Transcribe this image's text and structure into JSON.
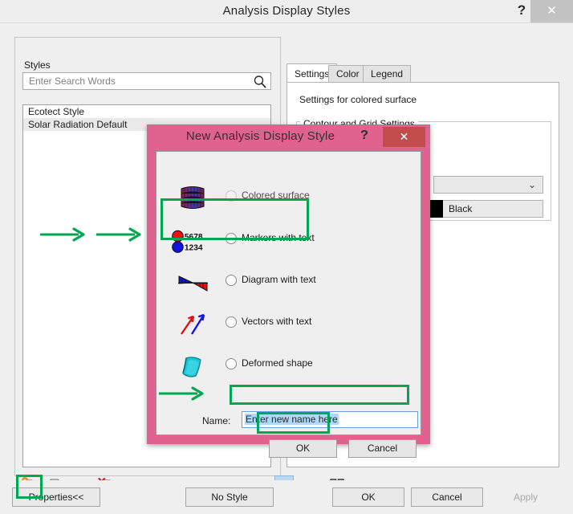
{
  "window": {
    "title": "Analysis Display Styles",
    "help_label": "?",
    "close_label": "✕"
  },
  "styles_panel": {
    "legend": "Styles",
    "search": {
      "placeholder": "Enter Search Words",
      "icon": "search-icon"
    },
    "list_items": [
      {
        "label": "Ecotect Style",
        "selected": false
      },
      {
        "label": "Solar Radiation Default",
        "selected": true
      }
    ],
    "toolbar": {
      "new_style": "new-style-icon",
      "duplicate_style": "duplicate-style-icon",
      "rename_style": "rename-style-icon",
      "delete_style": "delete-style-icon",
      "view_list": "view-list-icon",
      "view_small_icons": "view-small-icons-icon",
      "view_large_icons": "view-large-icons-icon"
    }
  },
  "settings_panel": {
    "tabs": [
      {
        "label": "Settings",
        "active": true
      },
      {
        "label": "Color",
        "active": false
      },
      {
        "label": "Legend",
        "active": false
      }
    ],
    "heading": "Settings for colored surface",
    "group_legend": "Contour and Grid Settings",
    "combo_value": "",
    "combo_chevron": "⌄",
    "color_value": "Black",
    "color_hex": "#000000"
  },
  "dialog": {
    "title": "New Analysis Display Style",
    "help_label": "?",
    "close_label": "✕",
    "accent_hex": "#e0628f",
    "close_hex": "#c04c4c",
    "options": [
      {
        "label": "Colored surface",
        "icon": "colored-surface-icon",
        "selected": false,
        "disabled": true
      },
      {
        "label": "Markers with text",
        "icon": "markers-with-text-icon",
        "selected": false,
        "disabled": false
      },
      {
        "label": "Diagram with text",
        "icon": "diagram-with-text-icon",
        "selected": false,
        "disabled": false
      },
      {
        "label": "Vectors with text",
        "icon": "vectors-with-text-icon",
        "selected": false,
        "disabled": false
      },
      {
        "label": "Deformed shape",
        "icon": "deformed-shape-icon",
        "selected": false,
        "disabled": false
      }
    ],
    "marker_icon_values": {
      "top": "5678",
      "bottom": "1234",
      "top_hex": "#ee1111",
      "bottom_hex": "#1111dd"
    },
    "name_label": "Name:",
    "name_value": "Enter new name here",
    "ok_label": "OK",
    "cancel_label": "Cancel"
  },
  "bottom_bar": {
    "properties_label": "Properties<<",
    "no_style_label": "No Style",
    "ok_label": "OK",
    "cancel_label": "Cancel",
    "apply_label": "Apply"
  },
  "annotations": {
    "highlight_hex": "#00a651",
    "arrow_hex": "#00a651",
    "boxes": [
      "new-style-icon",
      "markers-with-text-option",
      "name-field",
      "ok-button"
    ],
    "arrows": [
      "arrow-to-dialog-1",
      "arrow-to-dialog-2",
      "arrow-to-name-field"
    ]
  }
}
